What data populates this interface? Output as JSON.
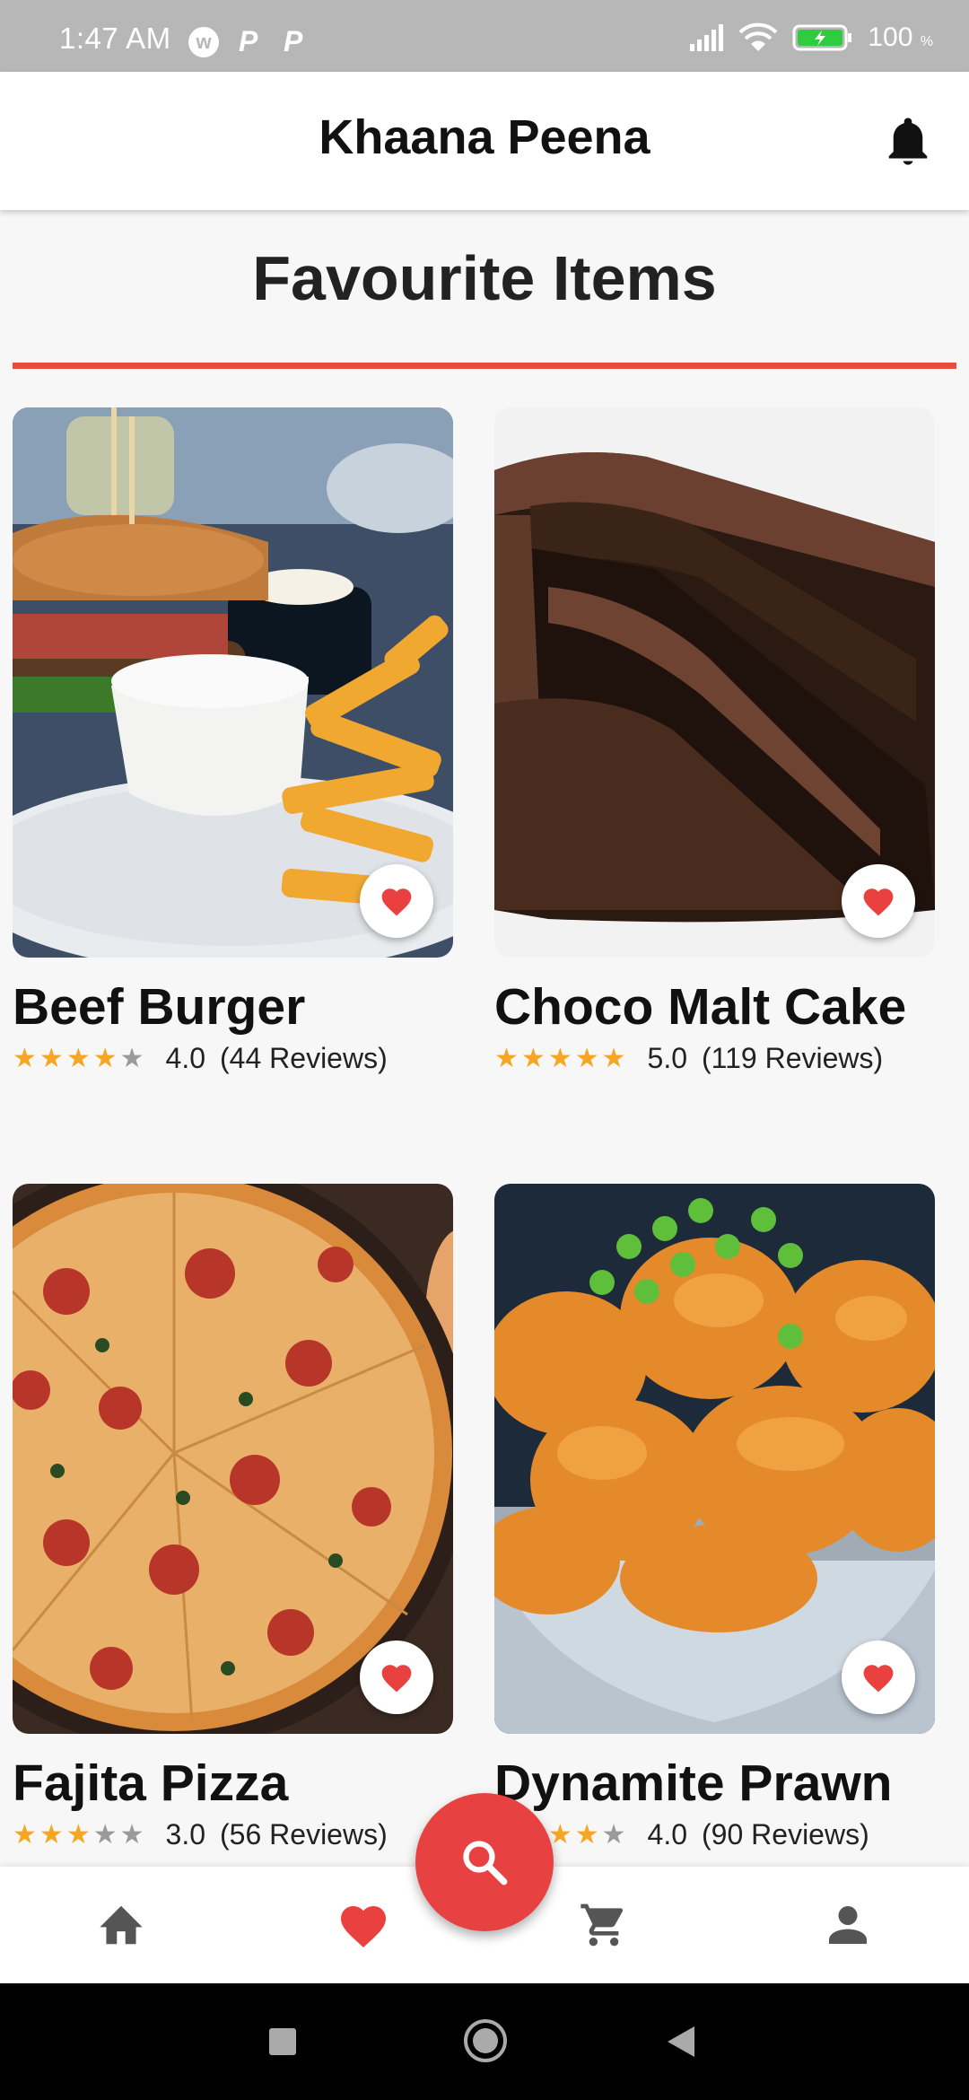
{
  "status_bar": {
    "time": "1:47 AM",
    "notification_icons": [
      "w-app-icon",
      "p-app-icon",
      "p-app-icon"
    ],
    "battery_percent": "100",
    "battery_unit": "%"
  },
  "app_bar": {
    "title": "Khaana Peena",
    "notification_icon": "bell-icon"
  },
  "section": {
    "title": "Favourite Items",
    "accent_color": "#e74c3c"
  },
  "items": [
    {
      "name": "Beef Burger",
      "rating": "4.0",
      "stars": 4,
      "reviews": "(44 Reviews)",
      "favourited": true
    },
    {
      "name": "Choco Malt Cake",
      "rating": "5.0",
      "stars": 5,
      "reviews": "(119 Reviews)",
      "favourited": true
    },
    {
      "name": "Fajita Pizza",
      "rating": "3.0",
      "stars": 3,
      "reviews": "(56 Reviews)",
      "favourited": true
    },
    {
      "name": "Dynamite Prawn",
      "rating": "4.0",
      "stars": 4,
      "reviews": "(90 Reviews)",
      "favourited": true
    }
  ],
  "bottom_nav": {
    "items": [
      "home-icon",
      "heart-icon",
      "cart-icon",
      "profile-icon"
    ],
    "active": "heart-icon",
    "fab_icon": "search-icon",
    "fab_color": "#e84141"
  },
  "system_nav": [
    "recents-button",
    "home-button",
    "back-button"
  ]
}
